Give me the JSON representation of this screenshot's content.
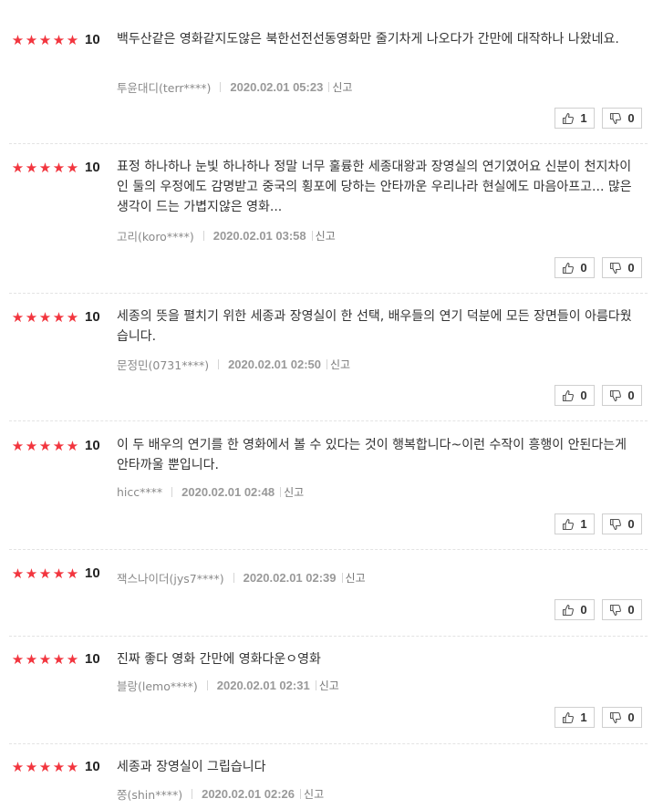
{
  "reviews": [
    {
      "stars": 5,
      "score": "10",
      "text": "백두산같은 영화같지도않은 북한선전선동영화만 줄기차게 나오다가 간만에 대작하나 나왔네요.",
      "author": "투윤대디(terr****)",
      "date": "2020.02.01 05:23",
      "report": "신고",
      "likes": "1",
      "dislikes": "0"
    },
    {
      "stars": 5,
      "score": "10",
      "text": "표정 하나하나 눈빛 하나하나 정말 너무 훌륭한 세종대왕과 장영실의 연기였어요 신분이 천지차이인 둘의 우정에도 감명받고 중국의 횡포에 당하는 안타까운 우리나라 현실에도 마음아프고... 많은 생각이 드는 가볍지않은 영화...",
      "author": "고리(koro****)",
      "date": "2020.02.01 03:58",
      "report": "신고",
      "likes": "0",
      "dislikes": "0"
    },
    {
      "stars": 5,
      "score": "10",
      "text": "세종의 뜻을 펼치기 위한 세종과 장영실이 한 선택, 배우들의 연기 덕분에 모든 장면들이 아름다웠습니다.",
      "author": "문정민(0731****)",
      "date": "2020.02.01 02:50",
      "report": "신고",
      "likes": "0",
      "dislikes": "0"
    },
    {
      "stars": 5,
      "score": "10",
      "text": "이 두 배우의 연기를 한 영화에서 볼 수 있다는 것이 행복합니다~이런 수작이 흥행이 안된다는게 안타까울 뿐입니다.",
      "author": "hicc****",
      "date": "2020.02.01 02:48",
      "report": "신고",
      "likes": "1",
      "dislikes": "0"
    },
    {
      "stars": 5,
      "score": "10",
      "text": "",
      "author": "잭스나이더(jys7****)",
      "date": "2020.02.01 02:39",
      "report": "신고",
      "likes": "0",
      "dislikes": "0"
    },
    {
      "stars": 5,
      "score": "10",
      "text": "진짜 좋다 영화 간만에 영화다운ㅇ영화",
      "author": "블랑(lemo****)",
      "date": "2020.02.01 02:31",
      "report": "신고",
      "likes": "1",
      "dislikes": "0"
    },
    {
      "stars": 5,
      "score": "10",
      "text": "세종과 장영실이 그립습니다",
      "author": "쫑(shin****)",
      "date": "2020.02.01 02:26",
      "report": "신고",
      "likes": "",
      "dislikes": ""
    }
  ],
  "icons": {
    "like": "thumbs-up-icon",
    "dislike": "thumbs-down-icon",
    "star": "star-icon"
  },
  "colors": {
    "star": "#f2353e",
    "text": "#333333",
    "meta": "#888888",
    "border": "#cfcfcf"
  }
}
